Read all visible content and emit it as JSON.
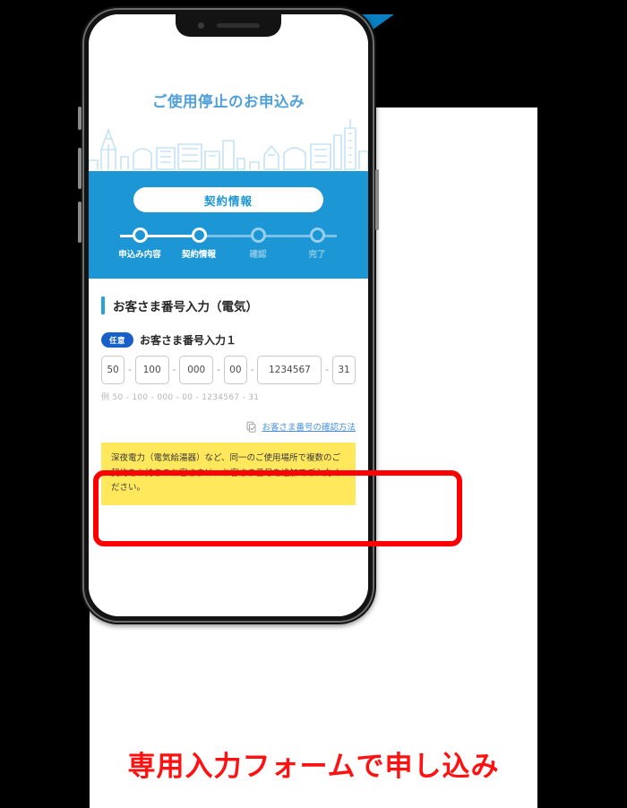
{
  "arrow": {
    "color": "#0a7fc2",
    "icon": "triangle-down-icon"
  },
  "caption": {
    "text": "専用入力フォームで申し込み",
    "color": "#ff1111"
  },
  "phone": {
    "notch": {
      "camera_icon": "front-camera-icon",
      "speaker_icon": "earpiece-speaker-icon"
    },
    "buttons": {
      "mute": "mute-switch",
      "volume_up": "volume-up-button",
      "volume_down": "volume-down-button",
      "power": "power-button"
    }
  },
  "page": {
    "hero": {
      "title": "ご使用停止のお申込み",
      "title_color": "#4f9fd8",
      "skyline_icon": "city-skyline-illustration"
    },
    "stepband": {
      "background": "#1c96d4",
      "current_pill": "契約情報",
      "steps": [
        {
          "label": "申込み内容",
          "state": "done"
        },
        {
          "label": "契約情報",
          "state": "current"
        },
        {
          "label": "確認",
          "state": "todo"
        },
        {
          "label": "完了",
          "state": "todo"
        }
      ]
    },
    "section": {
      "accent_color": "#29a3e0",
      "title": "お客さま番号入力（電気）"
    },
    "field": {
      "badge": "任意",
      "badge_color": "#1660c8",
      "label": "お客さま番号入力１",
      "separator": "-",
      "inputs": [
        {
          "name": "segment-1",
          "value": "50",
          "placeholder": "50",
          "width": "w2"
        },
        {
          "name": "segment-2",
          "value": "100",
          "placeholder": "100",
          "width": "w3"
        },
        {
          "name": "segment-3",
          "value": "000",
          "placeholder": "000",
          "width": "w3"
        },
        {
          "name": "segment-4",
          "value": "00",
          "placeholder": "00",
          "width": "w2"
        },
        {
          "name": "segment-5",
          "value": "1234567",
          "placeholder": "1234567",
          "width": "w7"
        },
        {
          "name": "segment-6",
          "value": "31",
          "placeholder": "31",
          "width": "w2"
        }
      ],
      "example": "例 50 - 100 - 000 - 00 - 1234567 - 31"
    },
    "help": {
      "icon": "document-check-icon",
      "link_text": "お客さま番号の確認方法",
      "link_color": "#4a90d9"
    },
    "notice": {
      "background": "#ffe85c",
      "text": "深夜電力（電気給湯器）など、同一のご使用場所で複数のご契約をお持ちのお客さまは、お客さま番号を追加でご入力ください。"
    }
  },
  "highlight": {
    "color": "#ff0000",
    "target": "customer-number-input-group"
  }
}
